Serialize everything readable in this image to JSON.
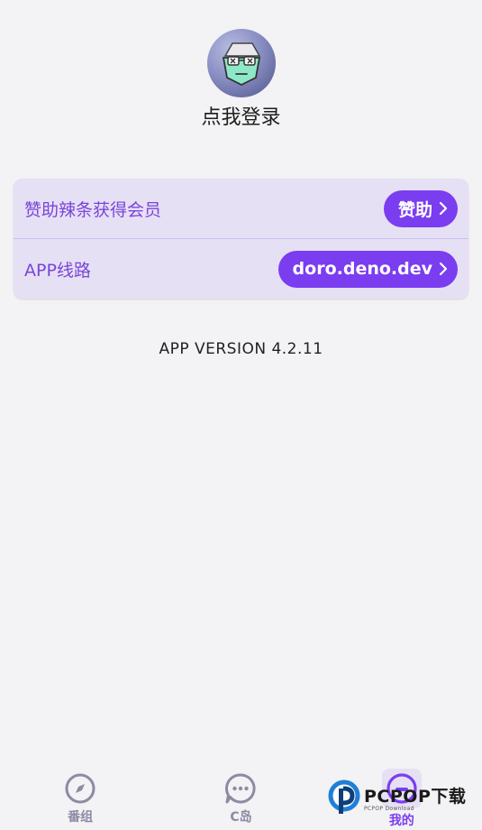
{
  "profile": {
    "login_text": "点我登录"
  },
  "settings": {
    "sponsor": {
      "label": "赞助辣条获得会员",
      "button_label": "赞助"
    },
    "route": {
      "label": "APP线路",
      "button_label": "doro.deno.dev"
    }
  },
  "version_text": "APP VERSION 4.2.11",
  "bottom_nav": {
    "items": [
      {
        "label": "番组",
        "icon": "compass-icon"
      },
      {
        "label": "C岛",
        "icon": "chat-bubble-icon"
      },
      {
        "label": "我的",
        "icon": "profile-icon",
        "active": true
      }
    ]
  },
  "watermark": {
    "main": "PCPOP下载",
    "sub": "PCPOP Download"
  },
  "colors": {
    "accent": "#7a3df0",
    "card_bg": "#e6e0f5",
    "label_purple": "#7a45d8",
    "inactive_nav": "#8d8aa3",
    "background": "#f3f2f4"
  }
}
